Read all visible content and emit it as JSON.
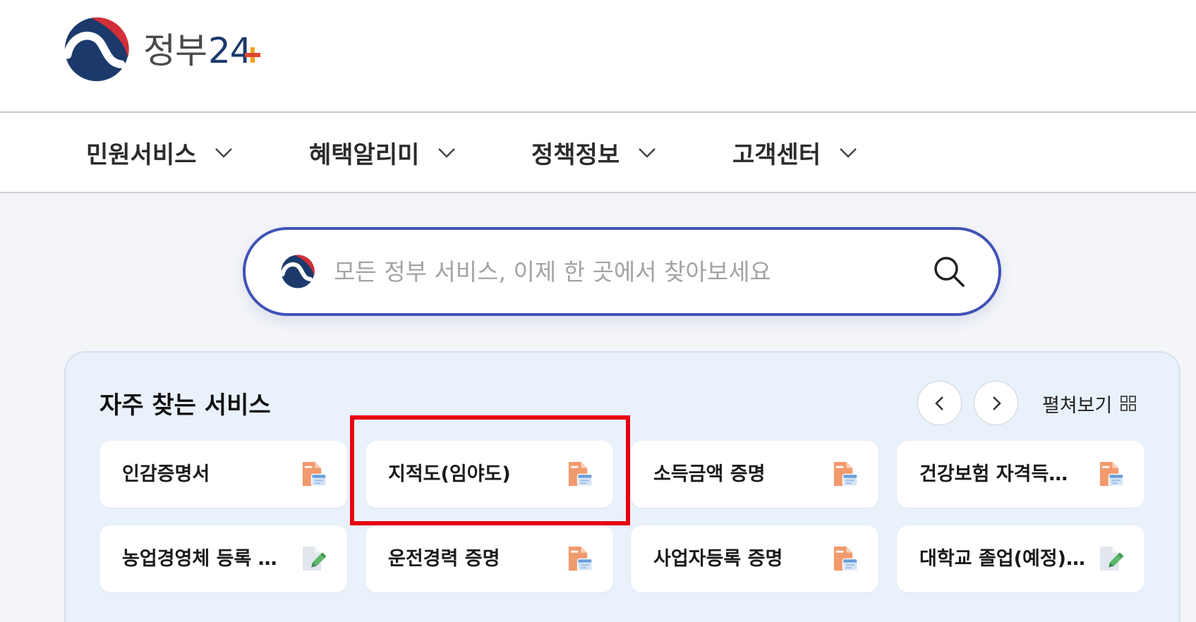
{
  "brand": {
    "name": "정부",
    "number": "24",
    "logo_icon": "government-emblem-icon"
  },
  "nav": {
    "items": [
      {
        "label": "민원서비스",
        "icon": "chevron-down-icon"
      },
      {
        "label": "혜택알리미",
        "icon": "chevron-down-icon"
      },
      {
        "label": "정책정보",
        "icon": "chevron-down-icon"
      },
      {
        "label": "고객센터",
        "icon": "chevron-down-icon"
      }
    ]
  },
  "search": {
    "placeholder": "모든 정부 서비스, 이제 한 곳에서 찾아보세요",
    "logo_icon": "government-emblem-icon",
    "icon": "search-icon"
  },
  "frequent_services": {
    "title": "자주 찾는 서비스",
    "prev_icon": "chevron-left-icon",
    "next_icon": "chevron-right-icon",
    "expand_label": "펼쳐보기",
    "expand_icon": "grid-icon",
    "items": [
      {
        "label": "인감증명서",
        "icon": "pdf-document-icon"
      },
      {
        "label": "지적도(임야도)",
        "icon": "pdf-document-icon",
        "highlighted": true
      },
      {
        "label": "소득금액 증명",
        "icon": "pdf-document-icon"
      },
      {
        "label": "건강보험 자격득…",
        "icon": "pdf-document-icon"
      },
      {
        "label": "농업경영체 등록 …",
        "icon": "edit-document-icon"
      },
      {
        "label": "운전경력 증명",
        "icon": "pdf-document-icon"
      },
      {
        "label": "사업자등록 증명",
        "icon": "pdf-document-icon"
      },
      {
        "label": "대학교 졸업(예정)…",
        "icon": "edit-document-icon"
      }
    ]
  },
  "colors": {
    "brand_navy": "#1b3a6b",
    "brand_red": "#d32f3a",
    "search_border": "#4152b6",
    "panel_background": "#e9f1fb",
    "highlight_border": "#e60012"
  }
}
